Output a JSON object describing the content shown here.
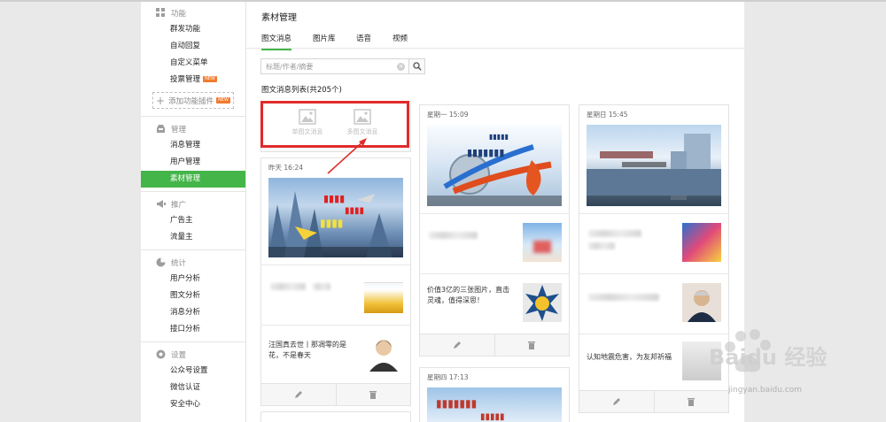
{
  "sidebar": {
    "groups": [
      {
        "title": "功能",
        "icon": "grid-icon",
        "items": [
          "群发功能",
          "自动回复",
          "自定义菜单",
          "投票管理"
        ],
        "new_badge": "NEW",
        "add_plugin": "添加功能插件",
        "add_badge": "NEW"
      },
      {
        "title": "管理",
        "icon": "inbox-icon",
        "items": [
          "消息管理",
          "用户管理",
          "素材管理"
        ],
        "active": "素材管理"
      },
      {
        "title": "推广",
        "icon": "megaphone-icon",
        "items": [
          "广告主",
          "流量主"
        ]
      },
      {
        "title": "统计",
        "icon": "pie-chart-icon",
        "items": [
          "用户分析",
          "图文分析",
          "消息分析",
          "接口分析"
        ]
      },
      {
        "title": "设置",
        "icon": "gear-icon",
        "items": [
          "公众号设置",
          "微信认证",
          "安全中心"
        ]
      }
    ]
  },
  "page": {
    "title": "素材管理",
    "tabs": [
      "图文消息",
      "图片库",
      "语音",
      "视频"
    ],
    "active_tab": "图文消息",
    "search": {
      "placeholder": "标题/作者/摘要",
      "value": ""
    },
    "list_count": "图文消息列表(共205个)",
    "new_single": "单图文消息",
    "new_multi": "多图文消息"
  },
  "cards": {
    "c1": {
      "date": "昨天 16:24",
      "row2_text": "汪国真去世丨那凋零的是花，不是春天"
    },
    "c2": {
      "date": "星期一 15:09",
      "row2_text": "价值3亿的三张图片，直击灵魂，值得深思！"
    },
    "c3": {
      "date": "星期日 15:45",
      "row3_text": "认知地震危害，为友邦祈福"
    },
    "c4": {
      "date": "星期四 17:13"
    }
  },
  "watermark": {
    "logo": "Baidu 经验",
    "url": "jingyan.baidu.com"
  },
  "colors": {
    "accent": "#44b549",
    "highlight": "#e02b2b"
  }
}
